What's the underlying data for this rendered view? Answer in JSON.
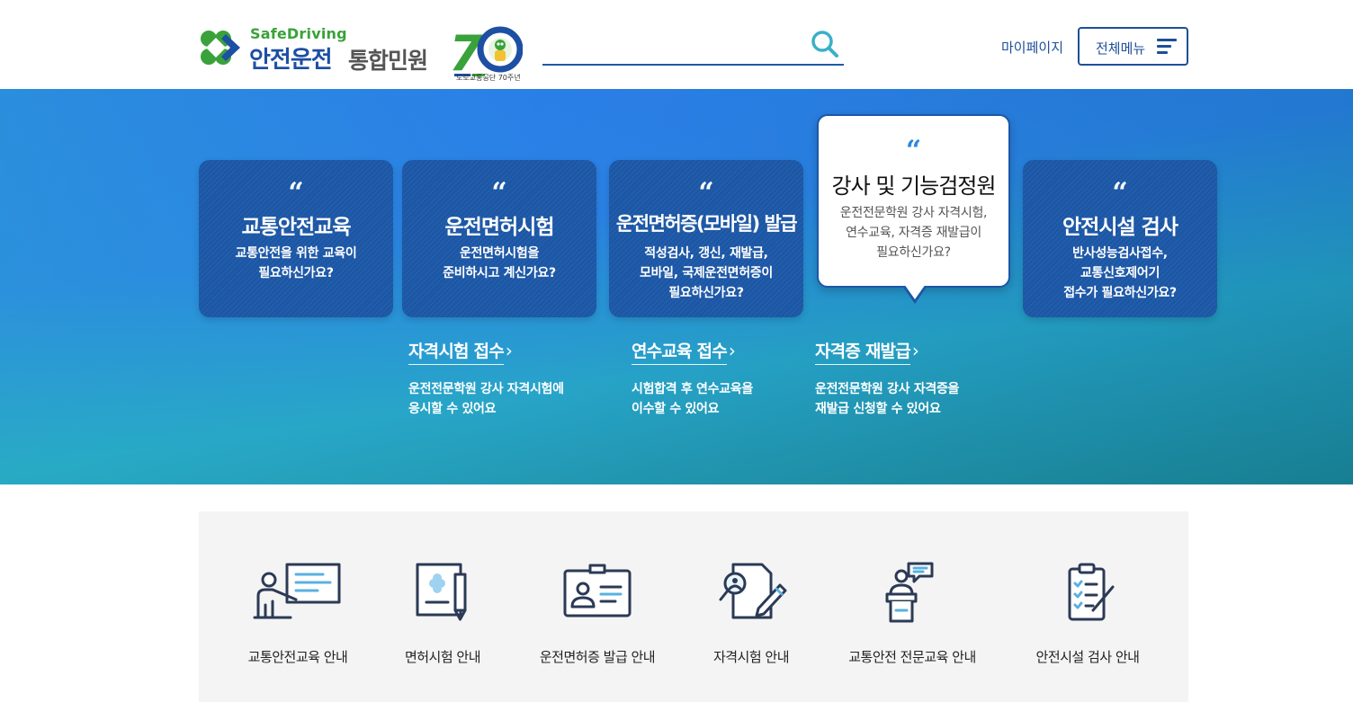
{
  "header": {
    "logo_sub": "SafeDriving",
    "logo_main": "안전운전",
    "logo_service": "통합민원",
    "anniversary_text": "70",
    "anniversary_caption": "도로교통공단 70주년",
    "search_value": "",
    "mypage_label": "마이페이지",
    "menu_label": "전체메뉴"
  },
  "colors": {
    "brand_blue": "#1c57a6",
    "accent_green": "#3aa23a",
    "search_accent": "#3ab0c8"
  },
  "cards": [
    {
      "title": "교통안전교육",
      "desc": "교통안전을 위한 교육이\n필요하신가요?",
      "quote": "“"
    },
    {
      "title": "운전면허시험",
      "desc": "운전면허시험을\n준비하시고 계신가요?",
      "quote": "“"
    },
    {
      "title": "운전면허증(모바일) 발급",
      "desc": "적성검사, 갱신, 재발급,\n모바일, 국제운전면허증이\n필요하신가요?",
      "quote": "“"
    },
    {
      "title": "강사 및 기능검정원",
      "desc": "운전전문학원 강사 자격시험,\n연수교육, 자격증 재발급이\n필요하신가요?",
      "quote": "“",
      "active": true
    },
    {
      "title": "안전시설 검사",
      "desc": "반사성능검사접수,\n교통신호제어기\n접수가 필요하신가요?",
      "quote": "“"
    }
  ],
  "sublinks": [
    {
      "title": "자격시험 접수",
      "arrow": "›",
      "desc": "운전전문학원 강사 자격시험에\n응시할 수 있어요"
    },
    {
      "title": "연수교육 접수",
      "arrow": "›",
      "desc": "시험합격 후 연수교육을\n이수할 수 있어요"
    },
    {
      "title": "자격증 재발급",
      "arrow": "›",
      "desc": "운전전문학원 강사 자격증을\n재발급 신청할 수 있어요"
    }
  ],
  "guides": [
    {
      "label": "교통안전교육 안내",
      "icon": "teacher-board-icon"
    },
    {
      "label": "면허시험 안내",
      "icon": "exam-document-pen-icon"
    },
    {
      "label": "운전면허증 발급 안내",
      "icon": "id-card-icon"
    },
    {
      "label": "자격시험 안내",
      "icon": "document-search-pen-icon"
    },
    {
      "label": "교통안전 전문교육 안내",
      "icon": "speaker-podium-icon"
    },
    {
      "label": "안전시설 검사 안내",
      "icon": "clipboard-checklist-icon"
    }
  ]
}
